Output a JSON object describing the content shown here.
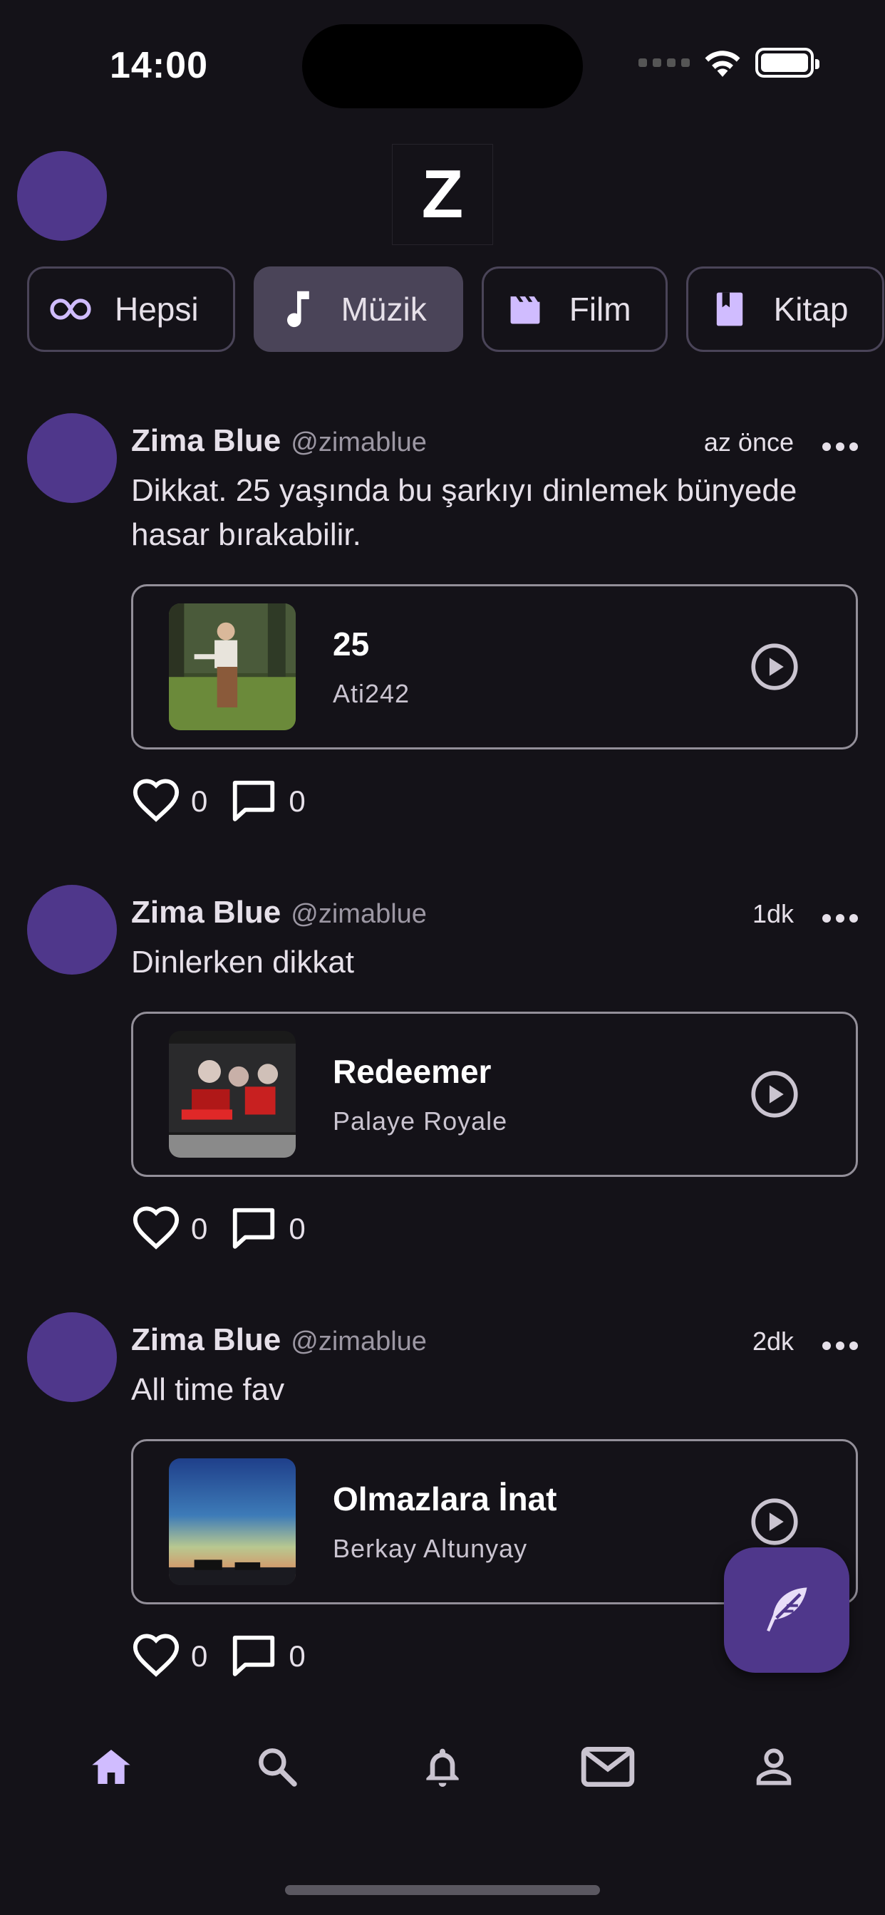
{
  "status_bar": {
    "time": "14:00"
  },
  "header": {
    "logo_text": "Z"
  },
  "colors": {
    "accent": "#4F378B",
    "chip_icon": "#D0BCFF",
    "background": "#141218"
  },
  "categories": [
    {
      "label": "Hepsi",
      "icon": "infinity-icon",
      "active": false
    },
    {
      "label": "Müzik",
      "icon": "music-note-icon",
      "active": true
    },
    {
      "label": "Film",
      "icon": "clapperboard-icon",
      "active": false
    },
    {
      "label": "Kitap",
      "icon": "book-icon",
      "active": false
    }
  ],
  "posts": [
    {
      "name": "Zima Blue",
      "handle": "@zimablue",
      "time": "az önce",
      "text": "Dikkat. 25 yaşında bu şarkıyı dinlemek bünyede hasar bırakabilir.",
      "track": {
        "title": "25",
        "artist": "Ati242"
      },
      "likes": "0",
      "comments": "0"
    },
    {
      "name": "Zima Blue",
      "handle": "@zimablue",
      "time": "1dk",
      "text": "Dinlerken dikkat",
      "track": {
        "title": "Redeemer",
        "artist": "Palaye Royale"
      },
      "likes": "0",
      "comments": "0"
    },
    {
      "name": "Zima Blue",
      "handle": "@zimablue",
      "time": "2dk",
      "text": "All time fav",
      "track": {
        "title": "Olmazlara İnat",
        "artist": "Berkay Altunyay"
      },
      "likes": "0",
      "comments": "0"
    }
  ],
  "fab": {
    "icon": "feather-icon"
  },
  "bottom_nav": [
    {
      "icon": "home-icon",
      "active": true
    },
    {
      "icon": "search-icon",
      "active": false
    },
    {
      "icon": "bell-icon",
      "active": false
    },
    {
      "icon": "mail-icon",
      "active": false
    },
    {
      "icon": "profile-icon",
      "active": false
    }
  ]
}
